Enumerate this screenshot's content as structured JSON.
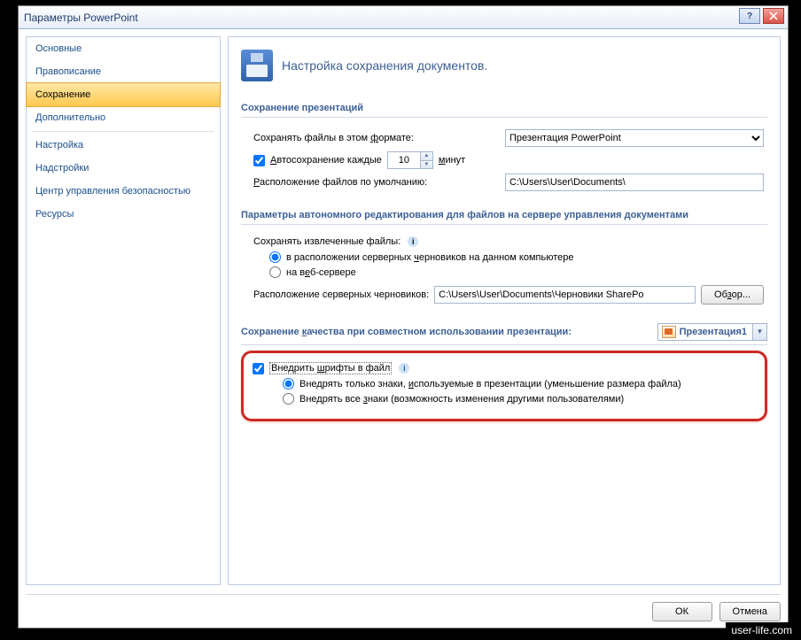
{
  "window": {
    "title": "Параметры PowerPoint"
  },
  "sidebar": {
    "items": [
      {
        "label": "Основные"
      },
      {
        "label": "Правописание"
      },
      {
        "label": "Сохранение"
      },
      {
        "label": "Дополнительно"
      },
      {
        "label": "Настройка"
      },
      {
        "label": "Надстройки"
      },
      {
        "label": "Центр управления безопасностью"
      },
      {
        "label": "Ресурсы"
      }
    ]
  },
  "header": {
    "text": "Настройка сохранения документов."
  },
  "section1": {
    "title": "Сохранение презентаций",
    "format_label_pre": "Сохранять файлы в этом ",
    "format_label_u": "ф",
    "format_label_post": "ормате:",
    "format_value": "Презентация PowerPoint",
    "autosave_pre": "",
    "autosave_u": "А",
    "autosave_post": "втосохранение каждые",
    "autosave_value": "10",
    "autosave_unit_u": "м",
    "autosave_unit_post": "инут",
    "location_label_u": "Р",
    "location_label_post": "асположение файлов по умолчанию:",
    "location_value": "C:\\Users\\User\\Documents\\"
  },
  "section2": {
    "title": "Параметры автономного редактирования для файлов на сервере управления документами",
    "save_extracted": "Сохранять извлеченные файлы:",
    "radio1_pre": "в расположении серверных ",
    "radio1_u": "ч",
    "radio1_post": "ерновиков на данном компьютере",
    "radio2_pre": "на в",
    "radio2_u": "е",
    "radio2_post": "б-сервере",
    "drafts_label": "Расположение серверных черновиков:",
    "drafts_value": "C:\\Users\\User\\Documents\\Черновики SharePo",
    "browse_pre": "Об",
    "browse_u": "з",
    "browse_post": "ор..."
  },
  "section3": {
    "title_pre": "Сохранение ",
    "title_u": "к",
    "title_post": "ачества при совместном использовании презентации:",
    "pres_name": "Презентация1"
  },
  "embed": {
    "check_pre": "Внедрить ",
    "check_u": "ш",
    "check_post": "рифты в файл",
    "radio1_pre": "Внедрять только знаки, ",
    "radio1_u": "и",
    "radio1_post": "спользуемые в презентации (уменьшение размера файла)",
    "radio2_pre": "Внедрять все ",
    "radio2_u": "з",
    "radio2_post": "наки (возможность изменения другими пользователями)"
  },
  "footer": {
    "ok": "ОК",
    "cancel": "Отмена"
  },
  "watermark": "user-life.com"
}
